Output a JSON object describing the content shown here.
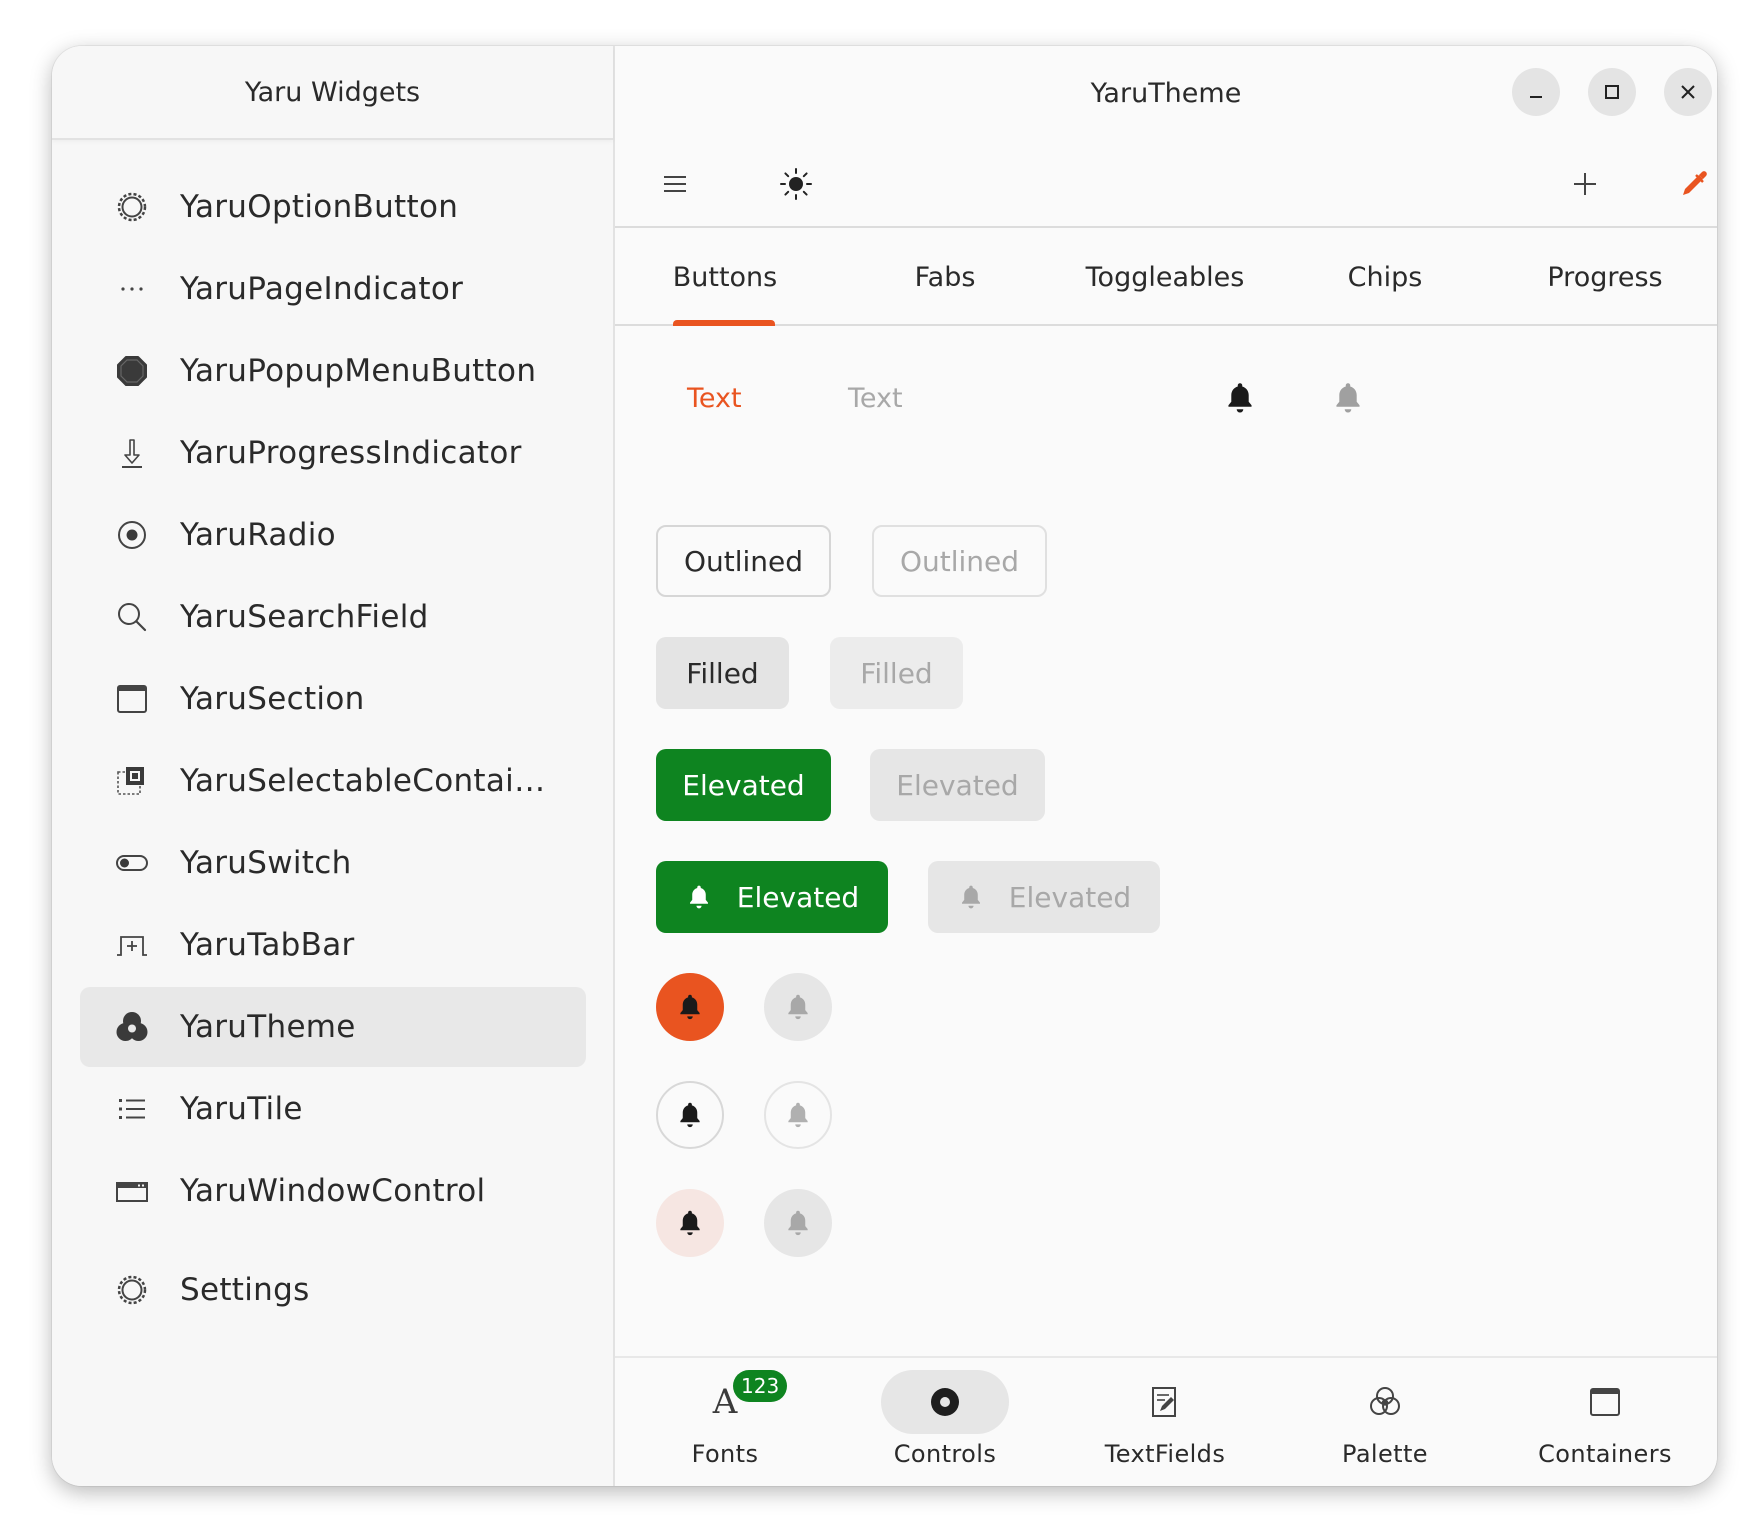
{
  "sidebar": {
    "title": "Yaru Widgets",
    "items": [
      {
        "label": "YaruOptionButton",
        "icon": "gear-icon"
      },
      {
        "label": "YaruPageIndicator",
        "icon": "dots-icon"
      },
      {
        "label": "YaruPopupMenuButton",
        "icon": "octagon-icon"
      },
      {
        "label": "YaruProgressIndicator",
        "icon": "download-arrow-icon"
      },
      {
        "label": "YaruRadio",
        "icon": "radio-icon"
      },
      {
        "label": "YaruSearchField",
        "icon": "search-icon"
      },
      {
        "label": "YaruSection",
        "icon": "window-section-icon"
      },
      {
        "label": "YaruSelectableContai…",
        "icon": "selectable-container-icon"
      },
      {
        "label": "YaruSwitch",
        "icon": "switch-icon"
      },
      {
        "label": "YaruTabBar",
        "icon": "tab-add-icon"
      },
      {
        "label": "YaruTheme",
        "icon": "theme-icon",
        "selected": true
      },
      {
        "label": "YaruTile",
        "icon": "list-icon"
      },
      {
        "label": "YaruWindowControl",
        "icon": "window-control-icon"
      }
    ],
    "settings_label": "Settings"
  },
  "main": {
    "title": "YaruTheme",
    "tabs": [
      {
        "label": "Buttons",
        "active": true
      },
      {
        "label": "Fabs"
      },
      {
        "label": "Toggleables"
      },
      {
        "label": "Chips"
      },
      {
        "label": "Progress"
      }
    ],
    "buttons": {
      "text_enabled": "Text",
      "text_disabled": "Text",
      "outlined_enabled": "Outlined",
      "outlined_disabled": "Outlined",
      "filled_enabled": "Filled",
      "filled_disabled": "Filled",
      "elevated_enabled": "Elevated",
      "elevated_disabled": "Elevated",
      "elevated_icon_enabled": "Elevated",
      "elevated_icon_disabled": "Elevated"
    }
  },
  "bottom_nav": {
    "items": [
      {
        "label": "Fonts",
        "icon": "font-icon",
        "badge": "123",
        "glyph": "A"
      },
      {
        "label": "Controls",
        "icon": "radio-control-icon",
        "active": true
      },
      {
        "label": "TextFields",
        "icon": "text-edit-icon"
      },
      {
        "label": "Palette",
        "icon": "palette-icon"
      },
      {
        "label": "Containers",
        "icon": "container-icon"
      }
    ]
  },
  "colors": {
    "accent": "#e95420",
    "success": "#0e8420",
    "selected_bg": "#e8e8e8"
  }
}
